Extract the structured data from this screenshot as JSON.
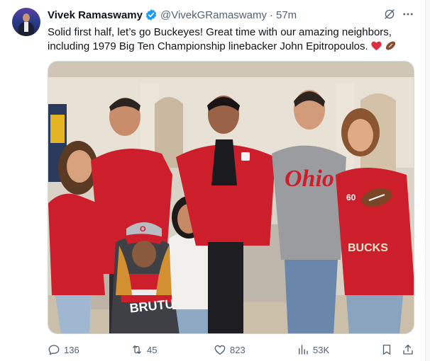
{
  "tweet": {
    "author_name": "Vivek Ramaswamy",
    "handle": "@VivekGRamaswamy",
    "separator": "·",
    "time": "57m",
    "text_line1": "Solid first half, let’s go Buckeyes! Great time with our amazing neighbors,",
    "text_line2": "including 1979 Big Ten Championship linebacker John Epitropoulos.",
    "emojis": [
      "red-heart-icon",
      "football-icon"
    ],
    "photo": {
      "shirt_text": "Ohio",
      "hat_text": "O",
      "poncho_text": "BRUTUS",
      "sweater_text": "BUCKS",
      "sweater_number": "60"
    }
  },
  "actions": {
    "replies": "136",
    "reposts": "45",
    "likes": "823",
    "views": "53K"
  },
  "colors": {
    "verified": "#1d9bf0",
    "text_primary": "#0f1419",
    "text_secondary": "#536471",
    "buckeye_red": "#cc1f2b"
  }
}
